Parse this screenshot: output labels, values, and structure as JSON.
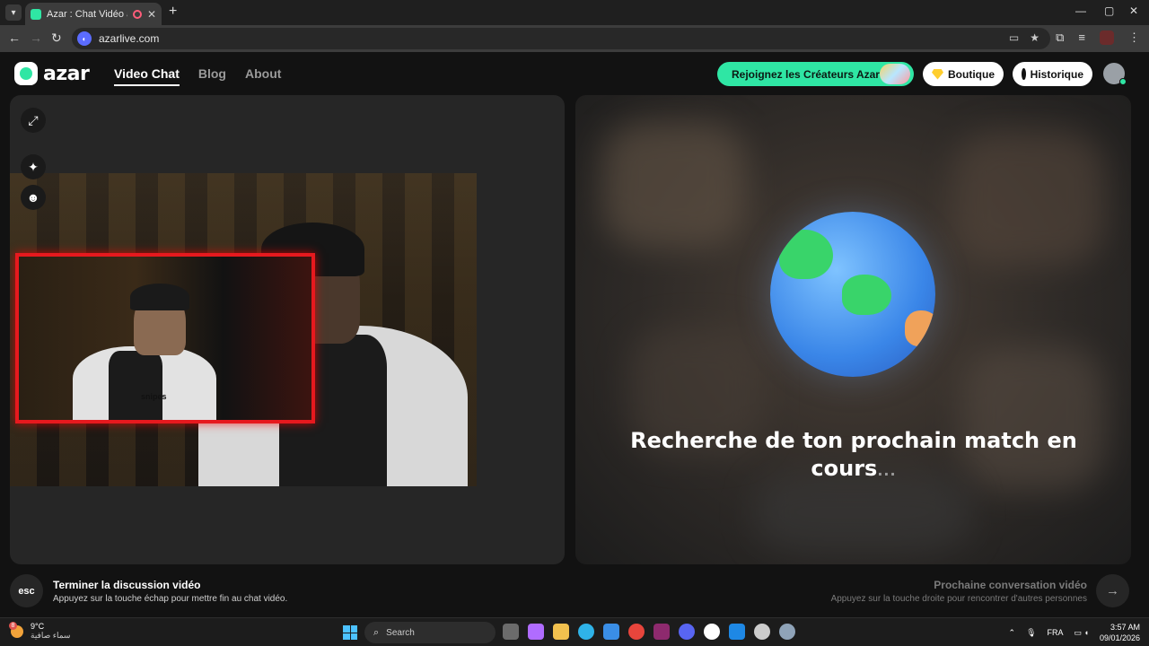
{
  "browser": {
    "tab_title": "Azar : Chat Vidéo avec de n",
    "tab_close": "✕",
    "new_tab": "+",
    "url": "azarlive.com",
    "window_controls": [
      "—",
      "▢",
      "✕"
    ]
  },
  "header": {
    "logo_text": "azar",
    "nav": [
      {
        "label": "Video Chat",
        "active": true
      },
      {
        "label": "Blog",
        "active": false
      },
      {
        "label": "About",
        "active": false
      }
    ],
    "creators_button": "Rejoignez les Créateurs Azar",
    "shop_button": "Boutique",
    "history_button": "Historique"
  },
  "match": {
    "searching_text": "Recherche de ton prochain match en cours",
    "dots": "..."
  },
  "video": {
    "overlay_caption": "snipes"
  },
  "bottom": {
    "esc_key": "esc",
    "end_title": "Terminer la discussion vidéo",
    "end_sub": "Appuyez sur la touche échap pour mettre fin au chat vidéo.",
    "next_title": "Prochaine conversation vidéo",
    "next_sub": "Appuyez sur la touche droite pour rencontrer d'autres personnes",
    "next_arrow": "→"
  },
  "taskbar": {
    "weather_badge": "8",
    "weather_temp": "9°C",
    "weather_desc": "سماء صافية",
    "search_label": "Search",
    "language": "FRA",
    "time": "3:57 AM",
    "date": "09/01/2026"
  },
  "colors": {
    "accent": "#2fe6a4",
    "overlay_border": "#e6191e"
  }
}
